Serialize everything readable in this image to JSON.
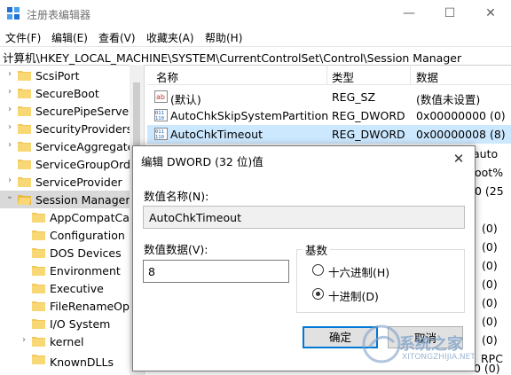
{
  "window": {
    "title": "注册表编辑器",
    "minimize": "—",
    "maximize": "☐",
    "close": "✕"
  },
  "menu": [
    "文件(F)",
    "编辑(E)",
    "查看(V)",
    "收藏夹(A)",
    "帮助(H)"
  ],
  "address": "计算机\\HKEY_LOCAL_MACHINE\\SYSTEM\\CurrentControlSet\\Control\\Session Manager",
  "tree": [
    {
      "label": "ScsiPort",
      "arrow": "›"
    },
    {
      "label": "SecureBoot",
      "arrow": "›"
    },
    {
      "label": "SecurePipeServers",
      "arrow": "›"
    },
    {
      "label": "SecurityProviders",
      "arrow": "›"
    },
    {
      "label": "ServiceAggregated",
      "arrow": "›"
    },
    {
      "label": "ServiceGroupOrder",
      "arrow": ""
    },
    {
      "label": "ServiceProvider",
      "arrow": "›"
    },
    {
      "label": "Session Manager",
      "arrow": "⌄",
      "selected": true
    },
    {
      "label": "AppCompatCac",
      "arrow": ""
    },
    {
      "label": "Configuration M",
      "arrow": ""
    },
    {
      "label": "DOS Devices",
      "arrow": ""
    },
    {
      "label": "Environment",
      "arrow": ""
    },
    {
      "label": "Executive",
      "arrow": ""
    },
    {
      "label": "FileRenameOpe",
      "arrow": ""
    },
    {
      "label": "I/O System",
      "arrow": ""
    },
    {
      "label": "kernel",
      "arrow": "›"
    },
    {
      "label": "KnownDLLs",
      "arrow": ""
    }
  ],
  "list": {
    "headers": [
      "名称",
      "类型",
      "数据"
    ],
    "rows": [
      {
        "name": "(默认)",
        "type": "REG_SZ",
        "data": "(数值未设置)",
        "icon": "string-value-icon"
      },
      {
        "name": "AutoChkSkipSystemPartition",
        "type": "REG_DWORD",
        "data": "0x00000000 (0)",
        "icon": "binary-value-icon"
      },
      {
        "name": "AutoChkTimeout",
        "type": "REG_DWORD",
        "data": "0x00000008 (8)",
        "icon": "binary-value-icon",
        "selected": true
      }
    ],
    "data_fragments": [
      "auto",
      "oot%",
      "0 (25",
      "(0)",
      "(0)",
      "(0)",
      "(0)",
      "(0)",
      "(0)",
      "(0)",
      "RPC",
      "0 (0)"
    ]
  },
  "dialog": {
    "title": "编辑 DWORD (32 位)值",
    "close": "✕",
    "name_label": "数值名称(N):",
    "name_value": "AutoChkTimeout",
    "data_label": "数值数据(V):",
    "data_value": "8",
    "base_label": "基数",
    "base_options": [
      {
        "label": "十六进制(H)",
        "checked": false
      },
      {
        "label": "十进制(D)",
        "checked": true
      }
    ],
    "ok": "确定",
    "cancel": "取消"
  },
  "watermark": {
    "text": "系统之家",
    "sub": "XITONGZHIJIA.NET"
  }
}
